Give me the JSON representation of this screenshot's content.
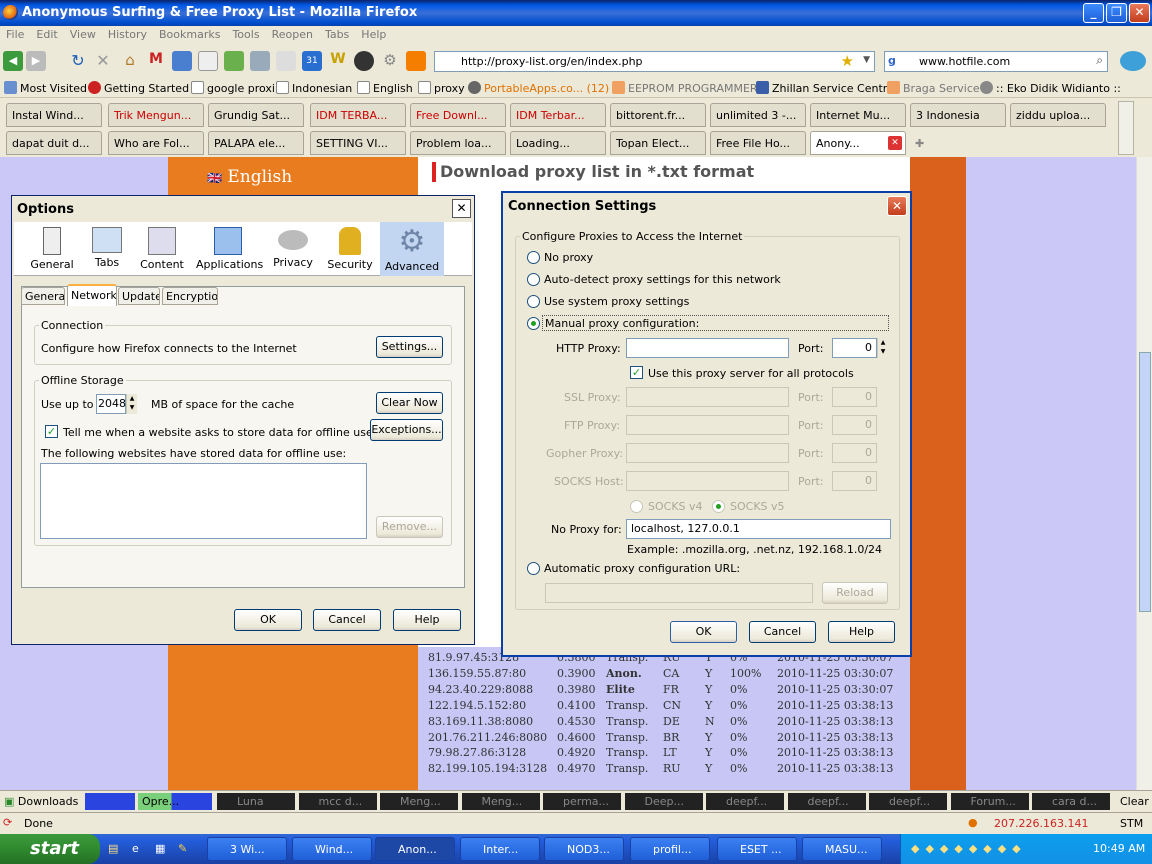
{
  "window": {
    "title": "Anonymous Surfing & Free Proxy List - Mozilla Firefox"
  },
  "menu": [
    "File",
    "Edit",
    "View",
    "History",
    "Bookmarks",
    "Tools",
    "Reopen",
    "Tabs",
    "Help"
  ],
  "nav": {
    "url": "http://proxy-list.org/en/index.php",
    "search": "www.hotfile.com"
  },
  "bookmarks": [
    "Most Visited",
    "Getting Started",
    "google proxi",
    "Indonesian",
    "English",
    "proxy",
    "PortableApps.co... (12)",
    "EEPROM PROGRAMMER",
    "Zhillan Service Centre",
    "Braga Service",
    ":: Eko Didik Widianto ::"
  ],
  "tabs_row1": [
    "Instal Wind...",
    "Trik Mengun...",
    "Grundig Sat...",
    "IDM TERBA...",
    "Free Downl...",
    "IDM Terbar...",
    "bittorent.fr...",
    "unlimited 3 -...",
    "Internet Mu...",
    "3 Indonesia",
    "ziddu uploa..."
  ],
  "tabs_row2": [
    "dapat duit d...",
    "Who are Fol...",
    "PALAPA ele...",
    "SETTING VI...",
    "Problem loa...",
    "Loading...",
    "Topan Elect...",
    "Free File Ho...",
    "Anony..."
  ],
  "page": {
    "language": "English",
    "heading": "Download proxy list in *.txt format",
    "rows": [
      {
        "ip": "81.9.97.45:3128",
        "t": "0.3800",
        "type": "Transp.",
        "cc": "RU",
        "ssl": "Y",
        "pct": "0%",
        "date": "2010-11-25 03:30:07"
      },
      {
        "ip": "136.159.55.87:80",
        "t": "0.3900",
        "type": "Anon.",
        "cc": "CA",
        "ssl": "Y",
        "pct": "100%",
        "date": "2010-11-25 03:30:07"
      },
      {
        "ip": "94.23.40.229:8088",
        "t": "0.3980",
        "type": "Elite",
        "cc": "FR",
        "ssl": "Y",
        "pct": "0%",
        "date": "2010-11-25 03:30:07"
      },
      {
        "ip": "122.194.5.152:80",
        "t": "0.4100",
        "type": "Transp.",
        "cc": "CN",
        "ssl": "Y",
        "pct": "0%",
        "date": "2010-11-25 03:38:13"
      },
      {
        "ip": "83.169.11.38:8080",
        "t": "0.4530",
        "type": "Transp.",
        "cc": "DE",
        "ssl": "N",
        "pct": "0%",
        "date": "2010-11-25 03:38:13"
      },
      {
        "ip": "201.76.211.246:8080",
        "t": "0.4600",
        "type": "Transp.",
        "cc": "BR",
        "ssl": "Y",
        "pct": "0%",
        "date": "2010-11-25 03:38:13"
      },
      {
        "ip": "79.98.27.86:3128",
        "t": "0.4920",
        "type": "Transp.",
        "cc": "LT",
        "ssl": "Y",
        "pct": "0%",
        "date": "2010-11-25 03:38:13"
      },
      {
        "ip": "82.199.105.194:3128",
        "t": "0.4970",
        "type": "Transp.",
        "cc": "RU",
        "ssl": "Y",
        "pct": "0%",
        "date": "2010-11-25 03:38:13"
      }
    ]
  },
  "options": {
    "title": "Options",
    "panes": [
      "General",
      "Tabs",
      "Content",
      "Applications",
      "Privacy",
      "Security",
      "Advanced"
    ],
    "subtabs": [
      "General",
      "Network",
      "Update",
      "Encryption"
    ],
    "connection_legend": "Connection",
    "connection_text": "Configure how Firefox connects to the Internet",
    "settings_btn": "Settings...",
    "offline_legend": "Offline Storage",
    "use_up_to": "Use up to",
    "cache_mb": "2048",
    "cache_suffix": "MB of space for the cache",
    "clear_now": "Clear Now",
    "tell_me": "Tell me when a website asks to store data for offline use",
    "exceptions": "Exceptions...",
    "stored_label": "The following websites have stored data for offline use:",
    "remove": "Remove...",
    "ok": "OK",
    "cancel": "Cancel",
    "help": "Help"
  },
  "conn": {
    "title": "Connection Settings",
    "legend": "Configure Proxies to Access the Internet",
    "no_proxy": "No proxy",
    "auto_detect": "Auto-detect proxy settings for this network",
    "system": "Use system proxy settings",
    "manual": "Manual proxy configuration:",
    "http_label": "HTTP Proxy:",
    "port_label": "Port:",
    "http_port": "0",
    "use_all": "Use this proxy server for all protocols",
    "ssl_label": "SSL Proxy:",
    "ftp_label": "FTP Proxy:",
    "gopher_label": "Gopher Proxy:",
    "socks_label": "SOCKS Host:",
    "zero": "0",
    "socks4": "SOCKS v4",
    "socks5": "SOCKS v5",
    "noproxy_label": "No Proxy for:",
    "noproxy_value": "localhost, 127.0.0.1",
    "example": "Example: .mozilla.org, .net.nz, 192.168.1.0/24",
    "auto_url": "Automatic proxy configuration URL:",
    "reload": "Reload",
    "ok": "OK",
    "cancel": "Cancel",
    "help": "Help"
  },
  "downloads_bar": {
    "label": "Downloads",
    "clear": "Clear",
    "items": [
      "Opre...",
      "Luna",
      "mcc d...",
      "Meng...",
      "Meng...",
      "perma...",
      "Deep...",
      "deepf...",
      "deepf...",
      "deepf...",
      "Forum...",
      "cara d..."
    ]
  },
  "status": {
    "text": "Done",
    "ip": "207.226.163.141",
    "stm": "STM"
  },
  "taskbar": {
    "start": "start",
    "items": [
      "3 Wi...",
      "Wind...",
      "Anon...",
      "Inter...",
      "NOD3...",
      "profil...",
      "ESET ...",
      "MASU..."
    ],
    "clock": "10:49 AM"
  }
}
